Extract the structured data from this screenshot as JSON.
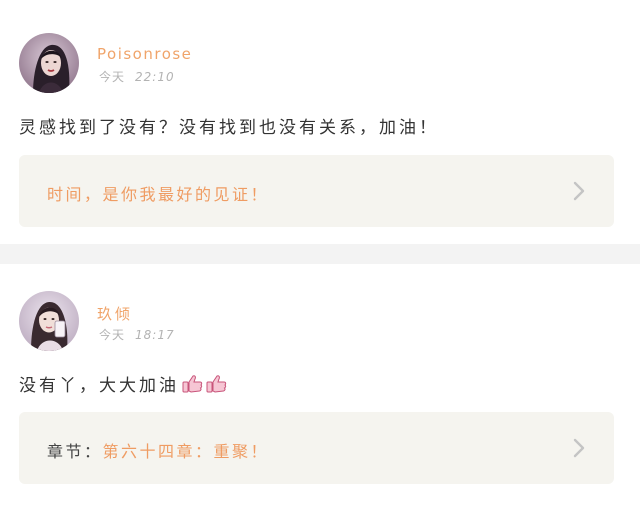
{
  "comments": [
    {
      "username": "Poisonrose",
      "time_label": "今天",
      "time_value": "22:10",
      "text": "灵感找到了没有？没有找到也没有关系，加油！",
      "reference": {
        "prefix": "",
        "title": "时间，是你我最好的见证！"
      }
    },
    {
      "username": "玖倾",
      "time_label": "今天",
      "time_value": "18:17",
      "text": "没有丫，大大加油",
      "emoji": [
        "thumbs-up-icon",
        "thumbs-up-icon"
      ],
      "reference": {
        "prefix": "章节：",
        "title": "第六十四章：重聚！"
      }
    }
  ],
  "colors": {
    "accent": "#ef9c63",
    "reference_bg": "#f5f4ef",
    "divider": "#f3f3f3",
    "timestamp": "#b3b3b3"
  }
}
